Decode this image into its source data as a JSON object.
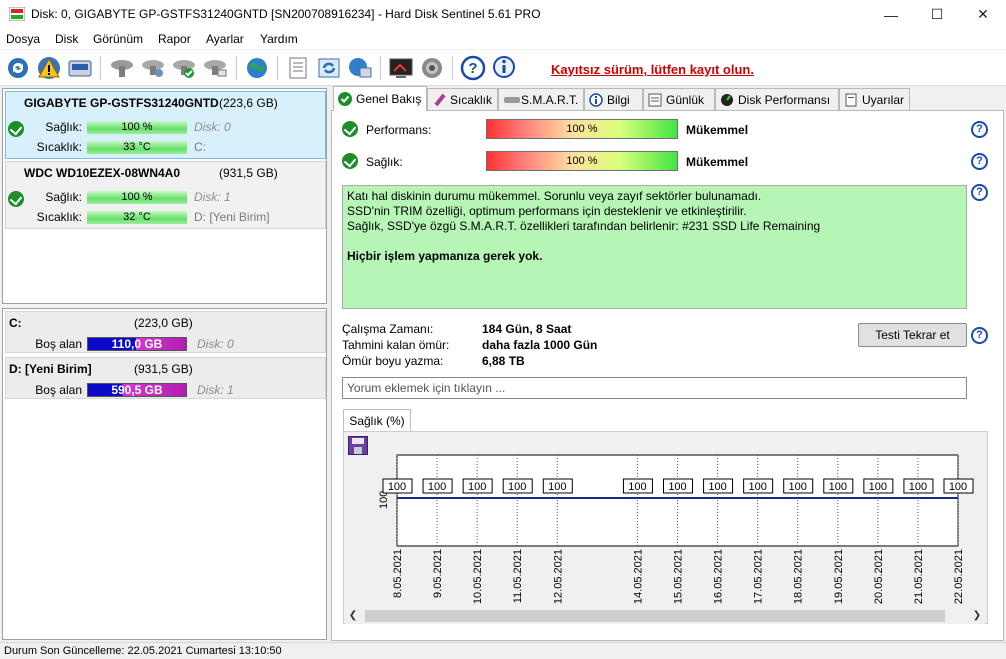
{
  "window": {
    "title": "Disk: 0, GIGABYTE GP-GSTFS31240GNTD [SN200708916234]  -  Hard Disk Sentinel 5.61 PRO",
    "minimize": "—",
    "maximize": "☐",
    "close": "✕"
  },
  "menu": [
    "Dosya",
    "Disk",
    "Görünüm",
    "Rapor",
    "Ayarlar",
    "Yardım"
  ],
  "toolbar": {
    "unregistered": "Kayıtsız sürüm, lütfen kayıt olun.",
    "icons": [
      "refresh-icon",
      "alert-icon",
      "disk-info-icon",
      "disk-gray-icon",
      "disk-settings-icon",
      "disk-check-icon",
      "disk-test-icon",
      "globe-icon",
      "report-icon",
      "update-icon",
      "network-icon",
      "terminal-icon",
      "sound-icon",
      "help-icon",
      "info-icon"
    ]
  },
  "disks": [
    {
      "name": "GIGABYTE GP-GSTFS31240GNTD",
      "size": "(223,6 GB)",
      "health_label": "Sağlık:",
      "health": "100 %",
      "health_pct": 100,
      "temp_label": "Sıcaklık:",
      "temp": "33 °C",
      "disk_index": "Disk: 0",
      "drives": "C:"
    },
    {
      "name": "WDC WD10EZEX-08WN4A0",
      "size": "(931,5 GB)",
      "health_label": "Sağlık:",
      "health": "100 %",
      "health_pct": 100,
      "temp_label": "Sıcaklık:",
      "temp": "32 °C",
      "disk_index": "Disk: 1",
      "drives": "D: [Yeni Birim]"
    }
  ],
  "volumes": [
    {
      "name": "C:",
      "size": "(223,0 GB)",
      "free_label": "Boş alan",
      "free": "110,0 GB",
      "disk": "Disk: 0"
    },
    {
      "name": "D: [Yeni Birim]",
      "size": "(931,5 GB)",
      "free_label": "Boş alan",
      "free": "590,5 GB",
      "disk": "Disk: 1"
    }
  ],
  "status_bar": "Durum Son Güncelleme: 22.05.2021 Cumartesi 13:10:50",
  "tabs": [
    "Genel Bakış",
    "Sıcaklık",
    "S.M.A.R.T.",
    "Bilgi",
    "Günlük",
    "Disk Performansı",
    "Uyarılar"
  ],
  "overview": {
    "performance_label": "Performans:",
    "performance_value": "100 %",
    "performance_text": "Mükemmel",
    "health_label": "Sağlık:",
    "health_value": "100 %",
    "health_text": "Mükemmel",
    "help": "?",
    "message": [
      "Katı hal diskinin durumu mükemmel. Sorunlu veya zayıf sektörler bulunamadı.",
      "SSD'nin TRIM özelliği, optimum performans için desteklenir ve etkinleştirilir.",
      "Sağlık, SSD'ye özgü S.M.A.R.T. özellikleri tarafından belirlenir: #231 SSD Life Remaining"
    ],
    "message_action": "Hiçbir işlem yapmanıza gerek yok.",
    "power_on_label": "Çalışma Zamanı:",
    "power_on_value": "184 Gün, 8 Saat",
    "remaining_label": "Tahmini kalan ömür:",
    "remaining_value": "daha fazla 1000 Gün",
    "written_label": "Ömür boyu yazma:",
    "written_value": "6,88 TB",
    "retest_button": "Testi Tekrar et",
    "comment_placeholder": "Yorum eklemek için tıklayın ..."
  },
  "chart_tab": "Sağlık (%)",
  "chart_data": {
    "type": "line",
    "ylabel_tick": "100",
    "x": [
      "8.05.2021",
      "9.05.2021",
      "10.05.2021",
      "11.05.2021",
      "12.05.2021",
      "14.05.2021",
      "15.05.2021",
      "16.05.2021",
      "17.05.2021",
      "18.05.2021",
      "19.05.2021",
      "20.05.2021",
      "21.05.2021",
      "22.05.2021"
    ],
    "values": [
      100,
      100,
      100,
      100,
      100,
      100,
      100,
      100,
      100,
      100,
      100,
      100,
      100,
      100
    ],
    "line_color": "#1a2a8a"
  }
}
